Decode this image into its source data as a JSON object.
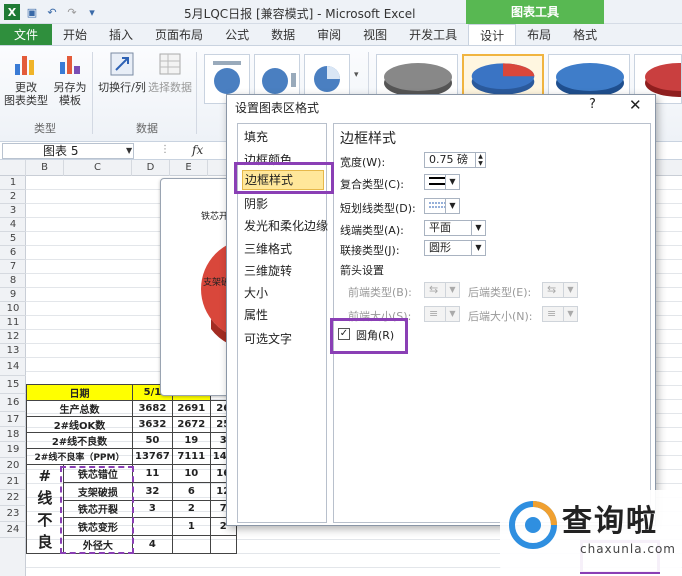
{
  "window": {
    "title": "5月LQC日报  [兼容模式] - Microsoft Excel",
    "context_tab": "图表工具"
  },
  "ribbon_tabs": [
    "文件",
    "开始",
    "插入",
    "页面布局",
    "公式",
    "数据",
    "审阅",
    "视图",
    "开发工具",
    "设计",
    "布局",
    "格式"
  ],
  "ribbon": {
    "change_chart_type_l1": "更改",
    "change_chart_type_l2": "图表类型",
    "save_template_l1": "另存为",
    "save_template_l2": "模板",
    "switch_row_col": "切换行/列",
    "select_data": "选择数据",
    "group_type": "类型",
    "group_data": "数据"
  },
  "formula_bar": {
    "name_box": "图表 5",
    "fx": "fx"
  },
  "columns": [
    "B",
    "C",
    "D",
    "E"
  ],
  "rows": [
    "1",
    "2",
    "3",
    "4",
    "5",
    "6",
    "7",
    "8",
    "9",
    "10",
    "11",
    "12",
    "13",
    "14",
    "15",
    "16",
    "17",
    "18",
    "19",
    "20",
    "21",
    "22",
    "23",
    "24"
  ],
  "table": {
    "date_header": "日期",
    "date_value": "5/1",
    "rows": [
      {
        "label": "生产总数",
        "v": [
          "3682",
          "2691",
          "26"
        ]
      },
      {
        "label": "2#线OK数",
        "v": [
          "3632",
          "2672",
          "25"
        ]
      },
      {
        "label": "2#线不良数",
        "v": [
          "50",
          "19",
          "3"
        ]
      },
      {
        "label": "2#线不良率（PPM）",
        "v": [
          "13767",
          "7111",
          "143"
        ]
      }
    ],
    "side_label": [
      "#",
      "线",
      "不",
      "良"
    ],
    "defects": [
      {
        "label": "铁芯错位",
        "v": [
          "11",
          "10",
          "16"
        ]
      },
      {
        "label": "支架破损",
        "v": [
          "32",
          "6",
          "12"
        ]
      },
      {
        "label": "铁芯开裂",
        "v": [
          "3",
          "2",
          "7"
        ]
      },
      {
        "label": "铁芯变形",
        "v": [
          "",
          "1",
          "2"
        ]
      },
      {
        "label": "外径大",
        "v": [
          "4",
          "",
          ""
        ]
      }
    ]
  },
  "chart_labels": {
    "label1": "铁芯开",
    "label2": "支架破"
  },
  "dialog": {
    "title": "设置图表区格式",
    "help": "?",
    "close": "✕",
    "nav": [
      "填充",
      "边框颜色",
      "边框样式",
      "阴影",
      "发光和柔化边缘",
      "三维格式",
      "三维旋转",
      "大小",
      "属性",
      "可选文字"
    ],
    "selected_nav_index": 2,
    "panel": {
      "heading": "边框样式",
      "width_label": "宽度(W):",
      "width_value": "0.75 磅",
      "compound_label": "复合类型(C):",
      "dash_label": "短划线类型(D):",
      "cap_label": "线端类型(A):",
      "cap_value": "平面",
      "join_label": "联接类型(J):",
      "join_value": "圆形",
      "arrow_section": "箭头设置",
      "begin_type": "前端类型(B):",
      "end_type": "后端类型(E):",
      "begin_size": "前端大小(S):",
      "end_size": "后端大小(N):",
      "rounded_label": "圆角(R)",
      "rounded_checked": true
    }
  },
  "watermark": {
    "text": "查询啦",
    "sub": "chaxunla.com"
  },
  "colors": {
    "highlight": "#8a3fb5",
    "file_tab": "#2f8f3d",
    "context_tab": "#58b852",
    "selected_nav": "#ffe79a",
    "date_header_bg": "#ffff00"
  }
}
